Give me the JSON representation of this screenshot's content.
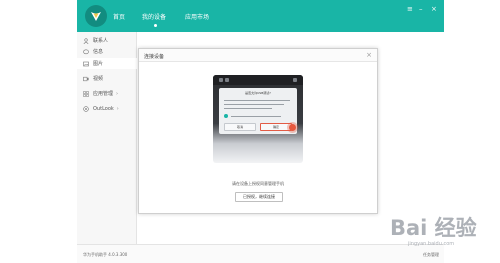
{
  "header": {
    "tabs": [
      {
        "label": "首页"
      },
      {
        "label": "我的设备"
      },
      {
        "label": "应用市场"
      }
    ],
    "active_tab": "我的设备",
    "window_controls": [
      "≡",
      "–",
      "×"
    ],
    "brand_color": "#19b5a6"
  },
  "sidebar": {
    "items": [
      {
        "label": "联系人",
        "icon": "person-icon"
      },
      {
        "label": "信息",
        "icon": "message-icon"
      },
      {
        "label": "图片",
        "icon": "image-icon"
      },
      {
        "label": "视频",
        "icon": "video-icon"
      },
      {
        "label": "应用管理",
        "icon": "apps-icon",
        "arrow": "›"
      },
      {
        "label": "OutLook",
        "icon": "outlook-icon",
        "arrow": "›"
      }
    ],
    "active_item": "图片"
  },
  "status": {
    "version": "华为手机助手 4.0.3.300",
    "task_manager": "任务管理"
  },
  "dialog": {
    "title": "连接设备",
    "close": "×",
    "phone_popup": {
      "title": "是否允许USB调试?",
      "cancel": "取消",
      "ok": "确定"
    },
    "hint": "请在设备上授权同意管理手机",
    "confirm_button": "已授权，继续连接"
  },
  "watermark": {
    "text": "Bai 经验",
    "url": "jingyan.baidu.com"
  }
}
